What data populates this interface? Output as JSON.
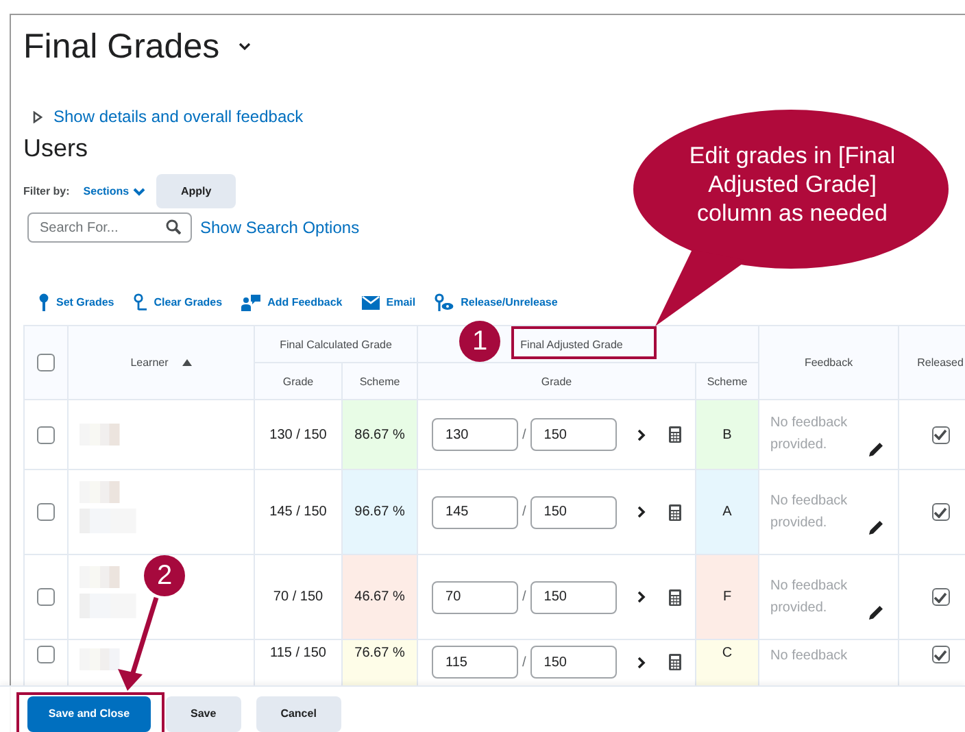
{
  "page": {
    "title": "Final Grades",
    "details_link": "Show details and overall feedback",
    "section_title": "Users"
  },
  "filter": {
    "label": "Filter by:",
    "dropdown": "Sections",
    "apply": "Apply"
  },
  "search": {
    "placeholder": "Search For...",
    "options_link": "Show Search Options"
  },
  "toolbar": [
    {
      "label": "Set Grades",
      "kind": "set"
    },
    {
      "label": "Clear Grades",
      "kind": "clear"
    },
    {
      "label": "Add Feedback",
      "kind": "feedback"
    },
    {
      "label": "Email",
      "kind": "email"
    },
    {
      "label": "Release/Unrelease",
      "kind": "release"
    }
  ],
  "table": {
    "select_all_checked": false,
    "columns": {
      "learner": "Learner",
      "calculated": "Final Calculated Grade",
      "adjusted": "Final Adjusted Grade",
      "grade": "Grade",
      "scheme": "Scheme",
      "adj_grade": "Grade",
      "adj_scheme": "Scheme",
      "feedback": "Feedback",
      "released": "Released"
    },
    "rows": [
      {
        "checked": false,
        "calculated_grade": "130 / 150",
        "calculated_scheme": "86.67 %",
        "grade": "130",
        "separator": "/",
        "out_of": "150",
        "scheme": "B",
        "color": "#e8fce6",
        "feedback": "No feedback provided.",
        "released": true
      },
      {
        "checked": false,
        "calculated_grade": "145 / 150",
        "calculated_scheme": "96.67 %",
        "grade": "145",
        "separator": "/",
        "out_of": "150",
        "scheme": "A",
        "color": "#e6f6fd",
        "feedback": "No feedback provided.",
        "released": true
      },
      {
        "checked": false,
        "calculated_grade": "70 / 150",
        "calculated_scheme": "46.67 %",
        "grade": "70",
        "separator": "/",
        "out_of": "150",
        "scheme": "F",
        "color": "#fdece6",
        "feedback": "No feedback provided.",
        "released": true
      },
      {
        "checked": false,
        "calculated_grade": "115 / 150",
        "calculated_scheme": "76.67 %",
        "grade": "115",
        "separator": "/",
        "out_of": "150",
        "scheme": "C",
        "color": "#fefde8",
        "feedback": "No feedback",
        "released": true
      }
    ]
  },
  "buttons": [
    {
      "label": "Save and Close",
      "kind": "primary"
    },
    {
      "label": "Save",
      "kind": "secondary"
    },
    {
      "label": "Cancel",
      "kind": "secondary"
    }
  ],
  "annotations": {
    "callout": "Edit grades in [Final Adjusted Grade] column as needed",
    "badges": [
      "1",
      "2"
    ]
  }
}
